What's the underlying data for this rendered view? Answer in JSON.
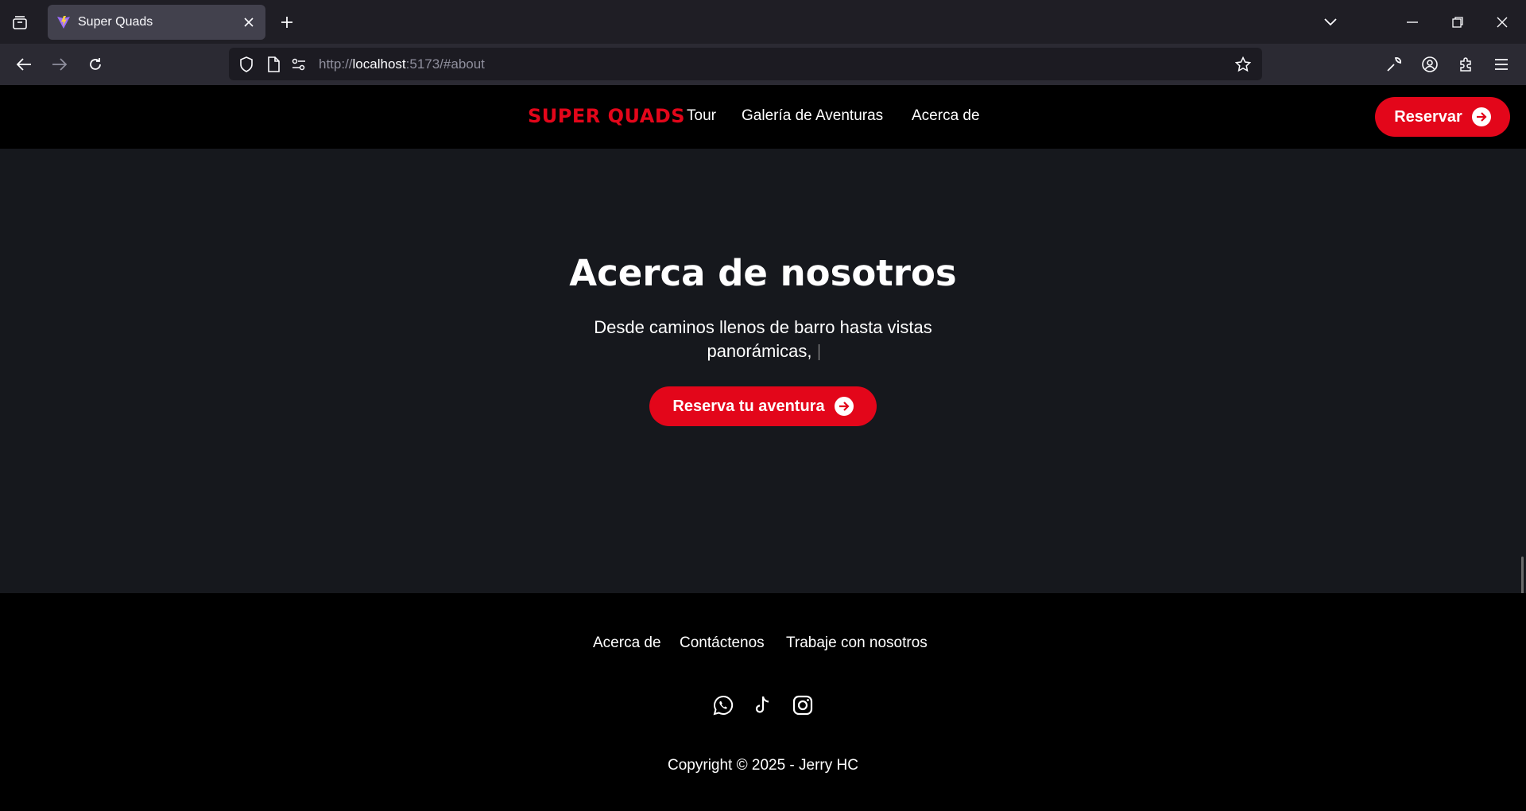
{
  "browser": {
    "tab_title": "Super Quads",
    "url_prefix": "http://",
    "url_host": "localhost",
    "url_rest": ":5173/#about"
  },
  "header": {
    "logo": "SUPER QUADS",
    "nav": [
      "Tour",
      "Galería de Aventuras",
      "Acerca de"
    ],
    "cta": "Reservar"
  },
  "about": {
    "title": "Acerca de nosotros",
    "text": "Desde caminos llenos de barro hasta vistas panorámicas,",
    "cta": "Reserva tu aventura"
  },
  "footer": {
    "links": [
      "Acerca de",
      "Contáctenos",
      "Trabaje con nosotros"
    ],
    "social_icons": [
      "whatsapp-icon",
      "tiktok-icon",
      "instagram-icon"
    ],
    "copyright": "Copyright © 2025 - Jerry HC"
  },
  "colors": {
    "brand_red": "#e3061a",
    "section_bg": "#16181d",
    "header_bg": "#000000"
  }
}
